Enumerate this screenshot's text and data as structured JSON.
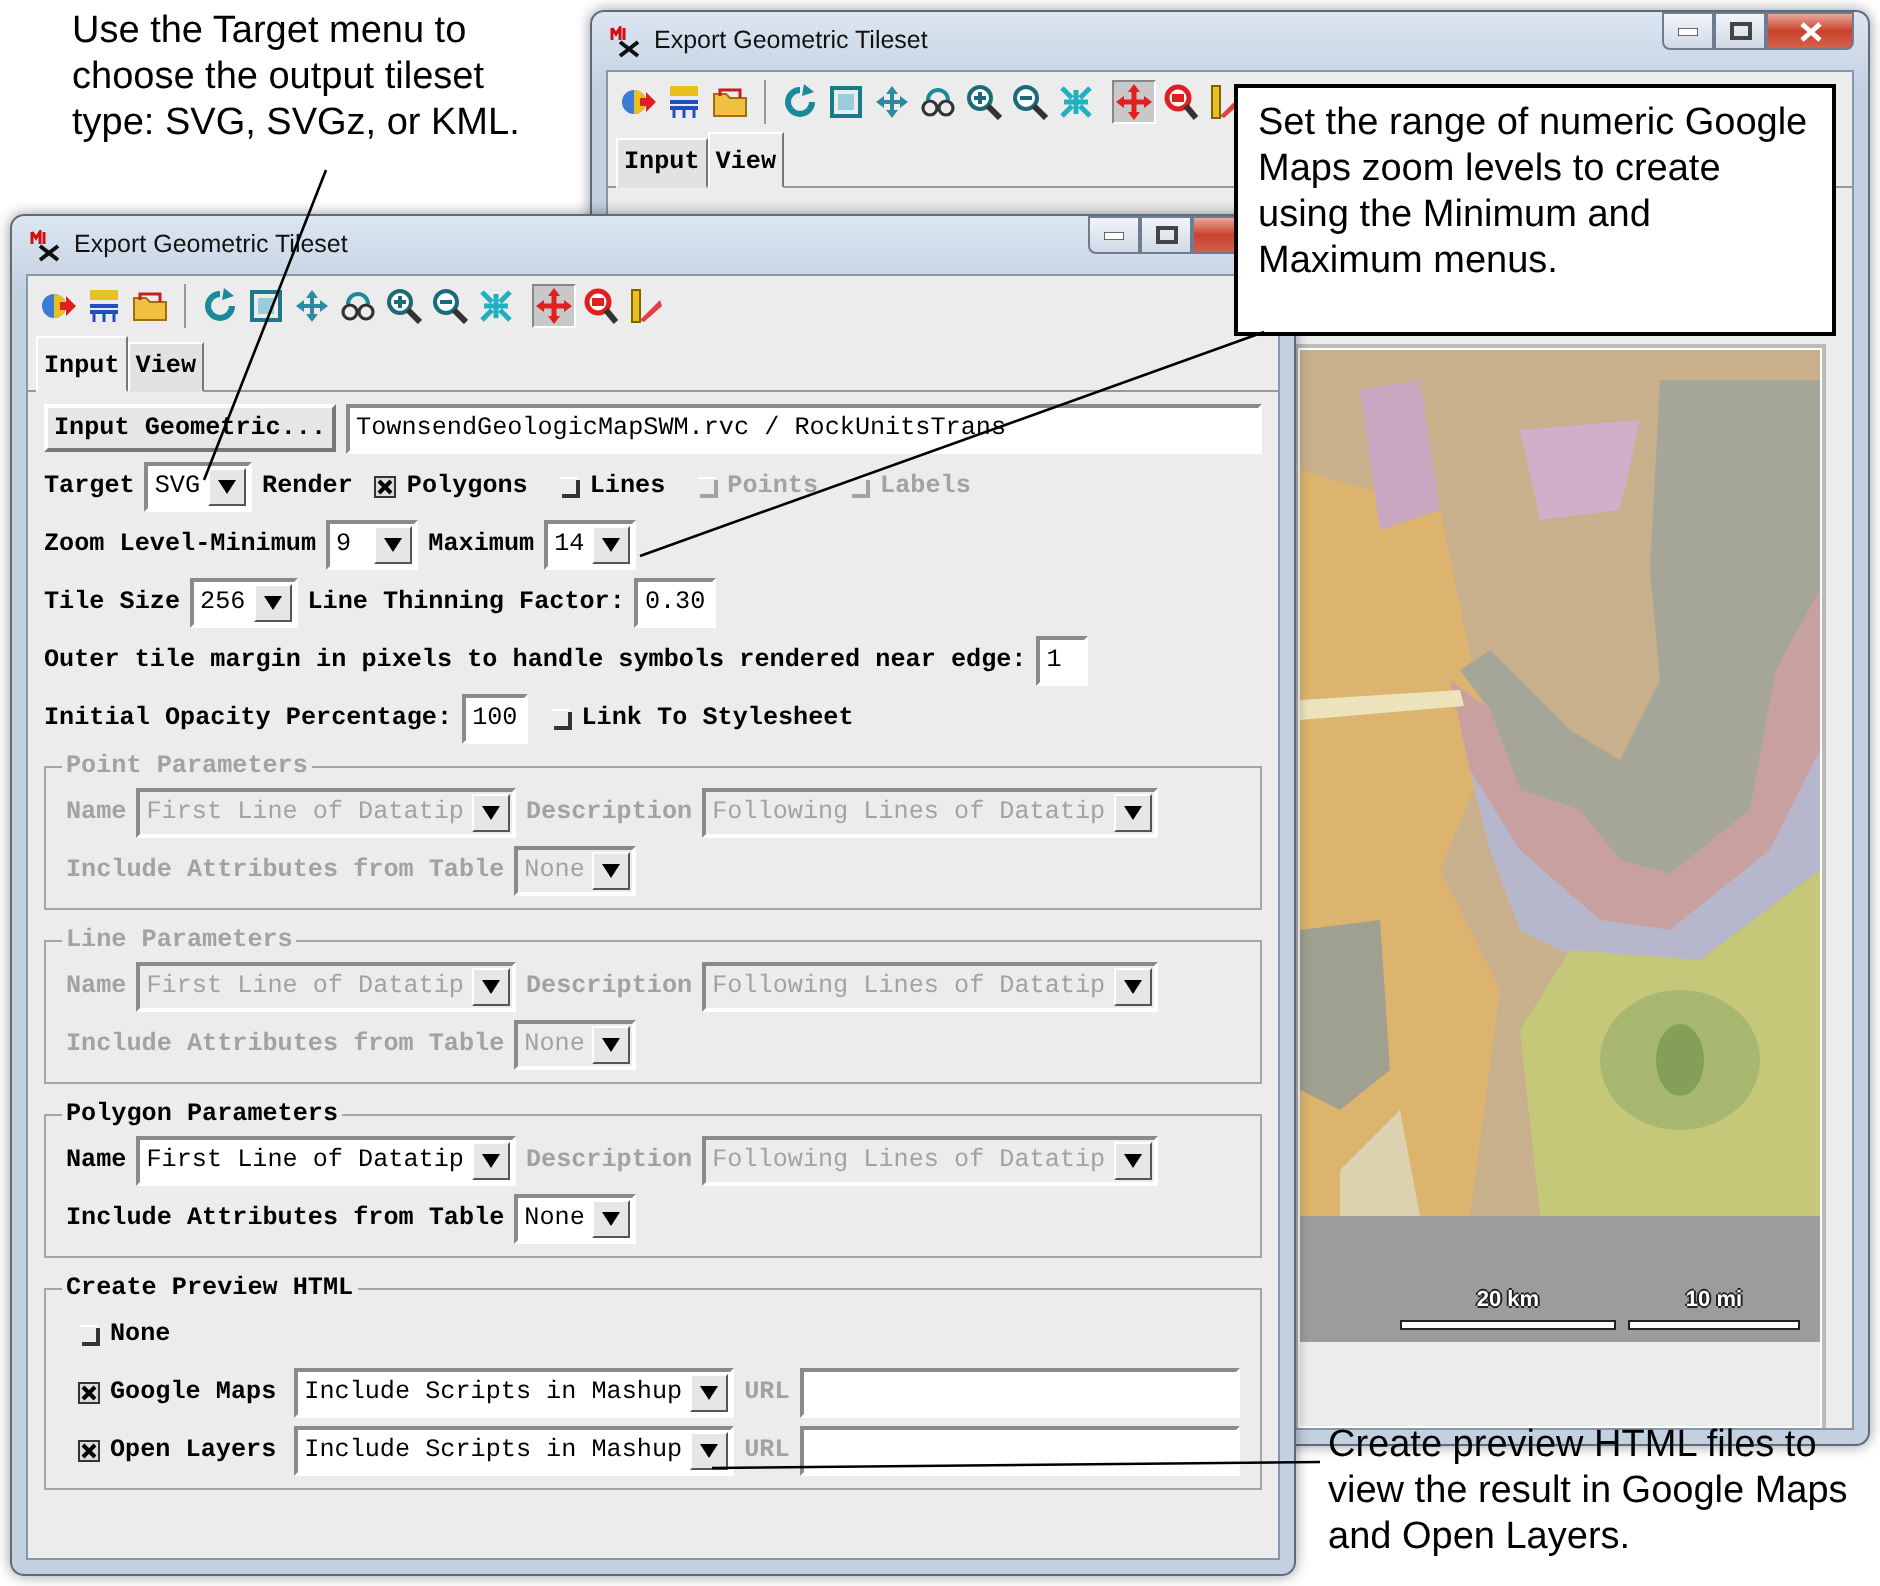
{
  "back_window": {
    "title": "Export Geometric Tileset",
    "toolbar": [
      {
        "selected": false
      },
      {
        "selected": false
      },
      {
        "selected": false
      },
      {
        "selected": false
      },
      {
        "selected": false
      },
      {
        "selected": false
      },
      {
        "selected": false
      },
      {
        "selected": false
      },
      {
        "selected": false
      },
      {
        "selected": false
      },
      {
        "selected": true
      },
      {
        "selected": false
      },
      {
        "selected": false
      }
    ],
    "tabs": [
      {
        "label": "Input",
        "selected": false
      },
      {
        "label": "View",
        "selected": true
      }
    ],
    "view": {
      "kind": "picture",
      "scale_bars": [
        "20 km",
        "10 mi"
      ]
    }
  },
  "front_window": {
    "title": "Export Geometric Tileset",
    "toolbar": [
      {
        "selected": false
      },
      {
        "selected": false
      },
      {
        "selected": false
      },
      {
        "selected": false
      },
      {
        "selected": false
      },
      {
        "selected": false
      },
      {
        "selected": false
      },
      {
        "selected": false
      },
      {
        "selected": false
      },
      {
        "selected": false
      },
      {
        "selected": true
      },
      {
        "selected": false
      },
      {
        "selected": false
      }
    ],
    "tabs": [
      {
        "label": "Input",
        "selected": true
      },
      {
        "label": "View",
        "selected": false
      }
    ],
    "form": [
      {
        "kind": "row",
        "items": [
          {
            "kind": "button",
            "text": "Input Geometric...",
            "disabled": false
          },
          {
            "kind": "text_field",
            "value": "TownsendGeologicMapSWM.rvc / RockUnitsTrans",
            "disabled": false
          }
        ]
      },
      {
        "kind": "row",
        "items": [
          {
            "kind": "label",
            "text": "Target",
            "disabled": false
          },
          {
            "kind": "dropdown",
            "value": "SVG",
            "disabled": false
          },
          {
            "kind": "label",
            "text": "Render",
            "disabled": false
          },
          {
            "kind": "check",
            "text": "Polygons",
            "checked": true,
            "disabled": false
          },
          {
            "kind": "check",
            "text": "Lines",
            "checked": false,
            "disabled": false
          },
          {
            "kind": "check",
            "text": "Points",
            "checked": false,
            "disabled": true
          },
          {
            "kind": "check",
            "text": "Labels",
            "checked": false,
            "disabled": true
          }
        ]
      },
      {
        "kind": "row",
        "items": [
          {
            "kind": "label",
            "text": "Zoom Level-Minimum",
            "disabled": false
          },
          {
            "kind": "dropdown",
            "value": "9",
            "disabled": false
          },
          {
            "kind": "label",
            "text": "Maximum",
            "disabled": false
          },
          {
            "kind": "dropdown",
            "value": "14",
            "disabled": false
          }
        ]
      },
      {
        "kind": "row",
        "items": [
          {
            "kind": "label",
            "text": "Tile Size",
            "disabled": false
          },
          {
            "kind": "dropdown",
            "value": "256",
            "disabled": false
          },
          {
            "kind": "label",
            "text": "Line Thinning Factor:",
            "disabled": false
          },
          {
            "kind": "number_field",
            "value": "0.30",
            "disabled": false
          }
        ]
      },
      {
        "kind": "row",
        "items": [
          {
            "kind": "label",
            "text": "Outer tile margin in pixels to handle symbols rendered near edge:",
            "disabled": false
          },
          {
            "kind": "number_field",
            "value": "1",
            "disabled": false
          }
        ]
      },
      {
        "kind": "row",
        "items": [
          {
            "kind": "label",
            "text": "Initial Opacity Percentage:",
            "disabled": false
          },
          {
            "kind": "number_field",
            "value": "100",
            "disabled": false
          },
          {
            "kind": "check",
            "text": "Link To Stylesheet",
            "checked": false,
            "disabled": false
          }
        ]
      },
      {
        "kind": "group",
        "title": "Point Parameters",
        "disabled": true,
        "rows": [
          {
            "items": [
              {
                "kind": "label",
                "text": "Name",
                "disabled": true
              },
              {
                "kind": "dropdown",
                "value": "First Line of Datatip",
                "disabled": true
              },
              {
                "kind": "label",
                "text": "Description",
                "disabled": true
              },
              {
                "kind": "dropdown",
                "value": "Following Lines of Datatip",
                "disabled": true
              }
            ]
          },
          {
            "items": [
              {
                "kind": "label",
                "text": "Include Attributes from Table",
                "disabled": true
              },
              {
                "kind": "dropdown",
                "value": "None",
                "disabled": true
              }
            ]
          }
        ]
      },
      {
        "kind": "group",
        "title": "Line Parameters",
        "disabled": true,
        "rows": [
          {
            "items": [
              {
                "kind": "label",
                "text": "Name",
                "disabled": true
              },
              {
                "kind": "dropdown",
                "value": "First Line of Datatip",
                "disabled": true
              },
              {
                "kind": "label",
                "text": "Description",
                "disabled": true
              },
              {
                "kind": "dropdown",
                "value": "Following Lines of Datatip",
                "disabled": true
              }
            ]
          },
          {
            "items": [
              {
                "kind": "label",
                "text": "Include Attributes from Table",
                "disabled": true
              },
              {
                "kind": "dropdown",
                "value": "None",
                "disabled": true
              }
            ]
          }
        ]
      },
      {
        "kind": "group",
        "title": "Polygon Parameters",
        "disabled": false,
        "rows": [
          {
            "items": [
              {
                "kind": "label",
                "text": "Name",
                "disabled": false
              },
              {
                "kind": "dropdown",
                "value": "First Line of Datatip",
                "disabled": false
              },
              {
                "kind": "label",
                "text": "Description",
                "disabled": true
              },
              {
                "kind": "dropdown",
                "value": "Following Lines of Datatip",
                "disabled": true
              }
            ]
          },
          {
            "items": [
              {
                "kind": "label",
                "text": "Include Attributes from Table",
                "disabled": false
              },
              {
                "kind": "dropdown",
                "value": "None",
                "disabled": false
              }
            ]
          }
        ]
      },
      {
        "kind": "group",
        "title": "Create Preview HTML",
        "disabled": false,
        "rows": [
          {
            "items": [
              {
                "kind": "check",
                "text": "None",
                "checked": false,
                "disabled": false
              }
            ]
          },
          {
            "items": [
              {
                "kind": "check",
                "text": "Google Maps",
                "checked": true,
                "disabled": false
              },
              {
                "kind": "dropdown",
                "value": "Include Scripts in Mashup",
                "disabled": false
              },
              {
                "kind": "label",
                "text": "URL",
                "disabled": true
              },
              {
                "kind": "text_field",
                "disabled": false
              }
            ]
          },
          {
            "items": [
              {
                "kind": "check",
                "text": "Open Layers",
                "checked": true,
                "disabled": false
              },
              {
                "kind": "dropdown",
                "value": "Include Scripts in Mashup",
                "disabled": false
              },
              {
                "kind": "label",
                "text": "URL",
                "disabled": true
              },
              {
                "kind": "text_field",
                "disabled": false
              }
            ]
          }
        ]
      }
    ]
  },
  "callouts": [
    {
      "text": "Use the Target menu to choose the output tileset type: SVG, SVGz, or KML.",
      "boxed": false
    },
    {
      "text": "Set the range of numeric Google Maps zoom levels to create using the Minimum and Maximum menus.",
      "boxed": true
    },
    {
      "text": "Create preview HTML files to view the result in Google Maps and Open Layers.",
      "boxed": false
    }
  ]
}
